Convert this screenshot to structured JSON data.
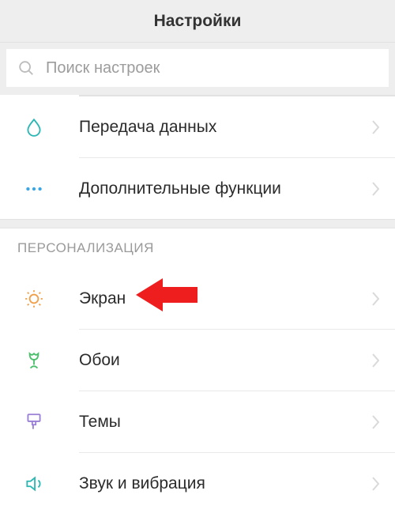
{
  "header": {
    "title": "Настройки"
  },
  "search": {
    "placeholder": "Поиск настроек"
  },
  "top_rows": [
    {
      "id": "data-transfer",
      "icon": "drop",
      "label": "Передача данных"
    },
    {
      "id": "more",
      "icon": "dots",
      "label": "Дополнительные функции"
    }
  ],
  "section": {
    "title": "ПЕРСОНАЛИЗАЦИЯ"
  },
  "personalization_rows": [
    {
      "id": "display",
      "icon": "sun",
      "label": "Экран",
      "highlighted": true
    },
    {
      "id": "wallpaper",
      "icon": "tulip",
      "label": "Обои"
    },
    {
      "id": "themes",
      "icon": "brush",
      "label": "Темы"
    },
    {
      "id": "sound",
      "icon": "speaker",
      "label": "Звук и вибрация"
    }
  ],
  "colors": {
    "teal": "#2bb7b3",
    "blue": "#3aa6e6",
    "orange": "#f0a04b",
    "green": "#4bbf6b",
    "purple": "#9a7fd6",
    "arrow": "#ef1e1e"
  }
}
